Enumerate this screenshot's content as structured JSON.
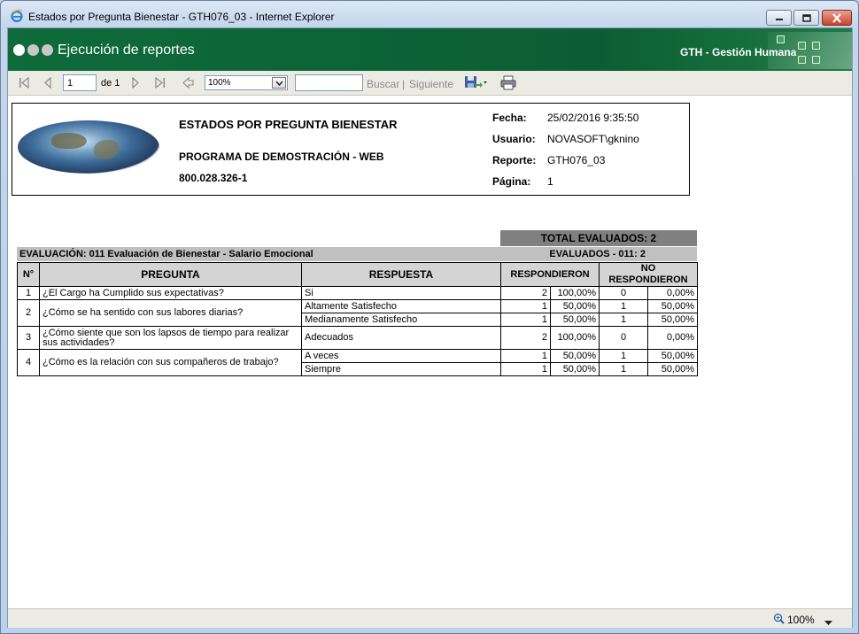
{
  "window": {
    "title": "Estados por Pregunta Bienestar - GTH076_03 - Internet Explorer"
  },
  "app_header": {
    "title": "Ejecución de reportes",
    "brand": "GTH - Gestión Humana"
  },
  "toolbar": {
    "page_value": "1",
    "page_of": "de 1",
    "zoom_value": "100%",
    "find_value": "",
    "find_label": "Buscar",
    "separator": "|",
    "next_label": "Siguiente"
  },
  "report": {
    "title": "ESTADOS POR PREGUNTA BIENESTAR",
    "company": "PROGRAMA DE DEMOSTRACIÓN - WEB",
    "nit": "800.028.326-1",
    "meta": [
      {
        "label": "Fecha:",
        "value": "25/02/2016 9:35:50"
      },
      {
        "label": "Usuario:",
        "value": "NOVASOFT\\gknino"
      },
      {
        "label": "Reporte:",
        "value": "GTH076_03"
      },
      {
        "label": "Página:",
        "value": "1"
      }
    ],
    "total_evaluados": "TOTAL EVALUADOS: 2",
    "evaluacion": "EVALUACIÓN: 011 Evaluación de Bienestar - Salario Emocional",
    "evaluados": "EVALUADOS - 011: 2",
    "columns": {
      "n": "N°",
      "pregunta": "PREGUNTA",
      "respuesta": "RESPUESTA",
      "respondieron": "RESPONDIERON",
      "no_respondieron": "NO RESPONDIERON"
    },
    "rows": [
      {
        "n": "1",
        "pregunta": "¿El Cargo ha Cumplido sus expectativas?",
        "respuesta": "Si",
        "resp": "2",
        "resp_pct": "100,00%",
        "no": "0",
        "no_pct": "0,00%"
      },
      {
        "n": "2",
        "pregunta": "¿Cómo se ha sentido con sus labores diarias?",
        "respuesta": "Altamente Satisfecho",
        "resp": "1",
        "resp_pct": "50,00%",
        "no": "1",
        "no_pct": "50,00%"
      },
      {
        "n": "",
        "pregunta": "",
        "respuesta": "Medianamente Satisfecho",
        "resp": "1",
        "resp_pct": "50,00%",
        "no": "1",
        "no_pct": "50,00%"
      },
      {
        "n": "3",
        "pregunta": "¿Cómo siente que son los lapsos de tiempo para realizar sus actividades?",
        "respuesta": "Adecuados",
        "resp": "2",
        "resp_pct": "100,00%",
        "no": "0",
        "no_pct": "0,00%"
      },
      {
        "n": "4",
        "pregunta": "¿Cómo es la relación con sus compañeros de trabajo?",
        "respuesta": "A veces",
        "resp": "1",
        "resp_pct": "50,00%",
        "no": "1",
        "no_pct": "50,00%"
      },
      {
        "n": "",
        "pregunta": "",
        "respuesta": "Siempre",
        "resp": "1",
        "resp_pct": "50,00%",
        "no": "1",
        "no_pct": "50,00%"
      }
    ]
  },
  "statusbar": {
    "zoom": "100%"
  },
  "icons": {
    "first": "first-page-icon",
    "prev": "previous-page-icon",
    "next": "next-page-icon",
    "last": "last-page-icon",
    "back": "back-to-parent-icon",
    "export": "export-save-icon",
    "print": "print-icon",
    "zoom": "zoom-magnifier-icon"
  },
  "colors": {
    "header_green": "#0b5e33",
    "toolbar_bg": "#ecebe3",
    "total_bar": "#808080",
    "eval_bar": "#c0c0c0",
    "header_cells": "#d4d4d4"
  }
}
